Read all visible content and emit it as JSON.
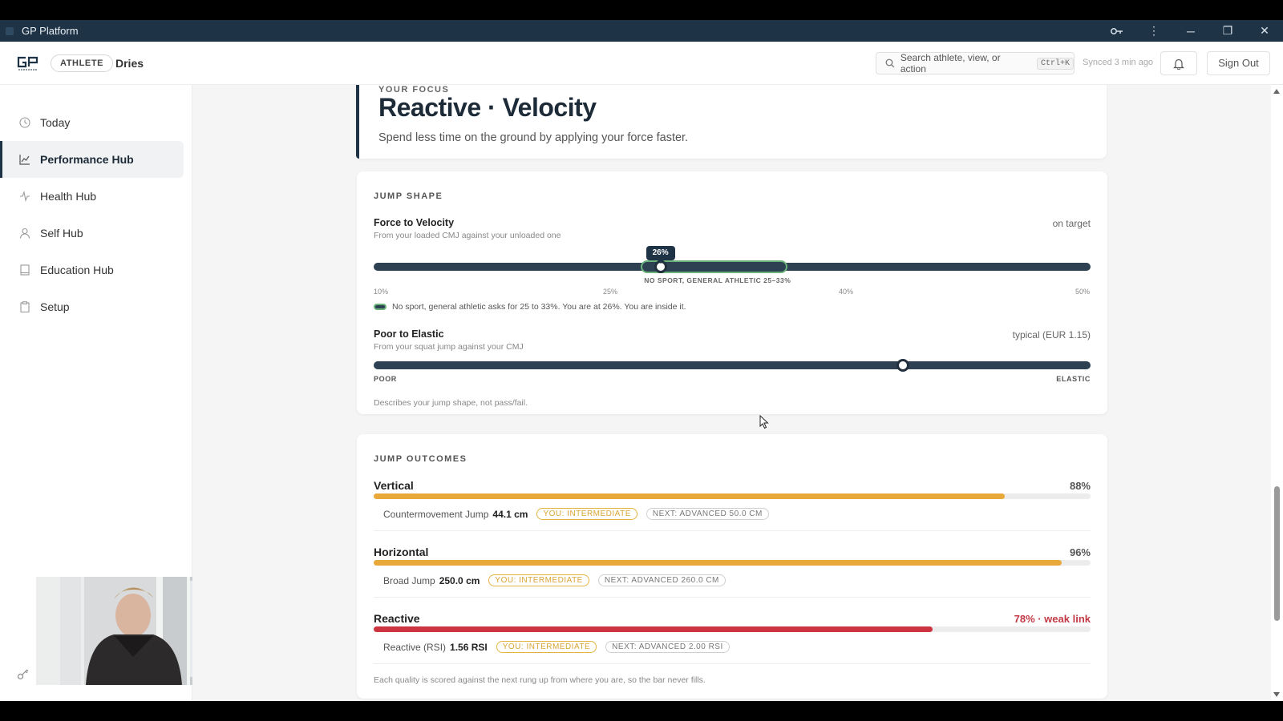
{
  "window": {
    "title": "GP Platform"
  },
  "header": {
    "role": "ATHLETE",
    "user": "Dries",
    "search_placeholder": "Search athlete, view, or action",
    "search_shortcut": "Ctrl+K",
    "synced": "Synced 3 min ago",
    "signout": "Sign Out"
  },
  "sidebar": {
    "items": [
      {
        "label": "Today",
        "icon": "clock-icon",
        "active": false
      },
      {
        "label": "Performance Hub",
        "icon": "chart-line-icon",
        "active": true
      },
      {
        "label": "Health Hub",
        "icon": "pulse-icon",
        "active": false
      },
      {
        "label": "Self Hub",
        "icon": "person-icon",
        "active": false
      },
      {
        "label": "Education Hub",
        "icon": "book-icon",
        "active": false
      },
      {
        "label": "Setup",
        "icon": "clipboard-icon",
        "active": false
      }
    ]
  },
  "hero": {
    "eyebrow": "YOUR FOCUS",
    "title": "Reactive · Velocity",
    "subtitle": "Spend less time on the ground by applying your force faster."
  },
  "jump_shape": {
    "section": "JUMP SHAPE",
    "force_velocity": {
      "title": "Force to Velocity",
      "subtitle": "From your loaded CMJ against your unloaded one",
      "status": "on target",
      "value_label": "26%",
      "value_pct": 26,
      "scale_min": 10,
      "scale_max": 50,
      "target_range": [
        25,
        33
      ],
      "target_label": "NO SPORT, GENERAL ATHLETIC 25–33%",
      "ticks": [
        "10%",
        "25%",
        "40%",
        "50%"
      ],
      "note": "No sport, general athletic asks for 25 to 33%. You are at 26%. You are inside it."
    },
    "poor_elastic": {
      "title": "Poor to Elastic",
      "subtitle": "From your squat jump against your CMJ",
      "status": "typical (EUR 1.15)",
      "position_fraction": 0.738,
      "left_label": "POOR",
      "right_label": "ELASTIC",
      "note": "Describes your jump shape, not pass/fail."
    }
  },
  "jump_outcomes": {
    "section": "JUMP OUTCOMES",
    "items": [
      {
        "title": "Vertical",
        "pct_label": "88%",
        "pct": 88,
        "color": "#e9a93a",
        "test": "Countermovement Jump",
        "value": "44.1 cm",
        "you": "YOU: INTERMEDIATE",
        "next": "NEXT: ADVANCED 50.0 CM"
      },
      {
        "title": "Horizontal",
        "pct_label": "96%",
        "pct": 96,
        "color": "#e9a93a",
        "test": "Broad Jump",
        "value": "250.0 cm",
        "you": "YOU: INTERMEDIATE",
        "next": "NEXT: ADVANCED 260.0 CM"
      },
      {
        "title": "Reactive",
        "pct_label": "78% · weak link",
        "pct": 78,
        "color": "#cc3440",
        "test": "Reactive (RSI)",
        "value": "1.56 RSI",
        "you": "YOU: INTERMEDIATE",
        "next": "NEXT: ADVANCED 2.00 RSI"
      }
    ],
    "footnote": "Each quality is scored against the next rung up from where you are, so the bar never fills."
  }
}
